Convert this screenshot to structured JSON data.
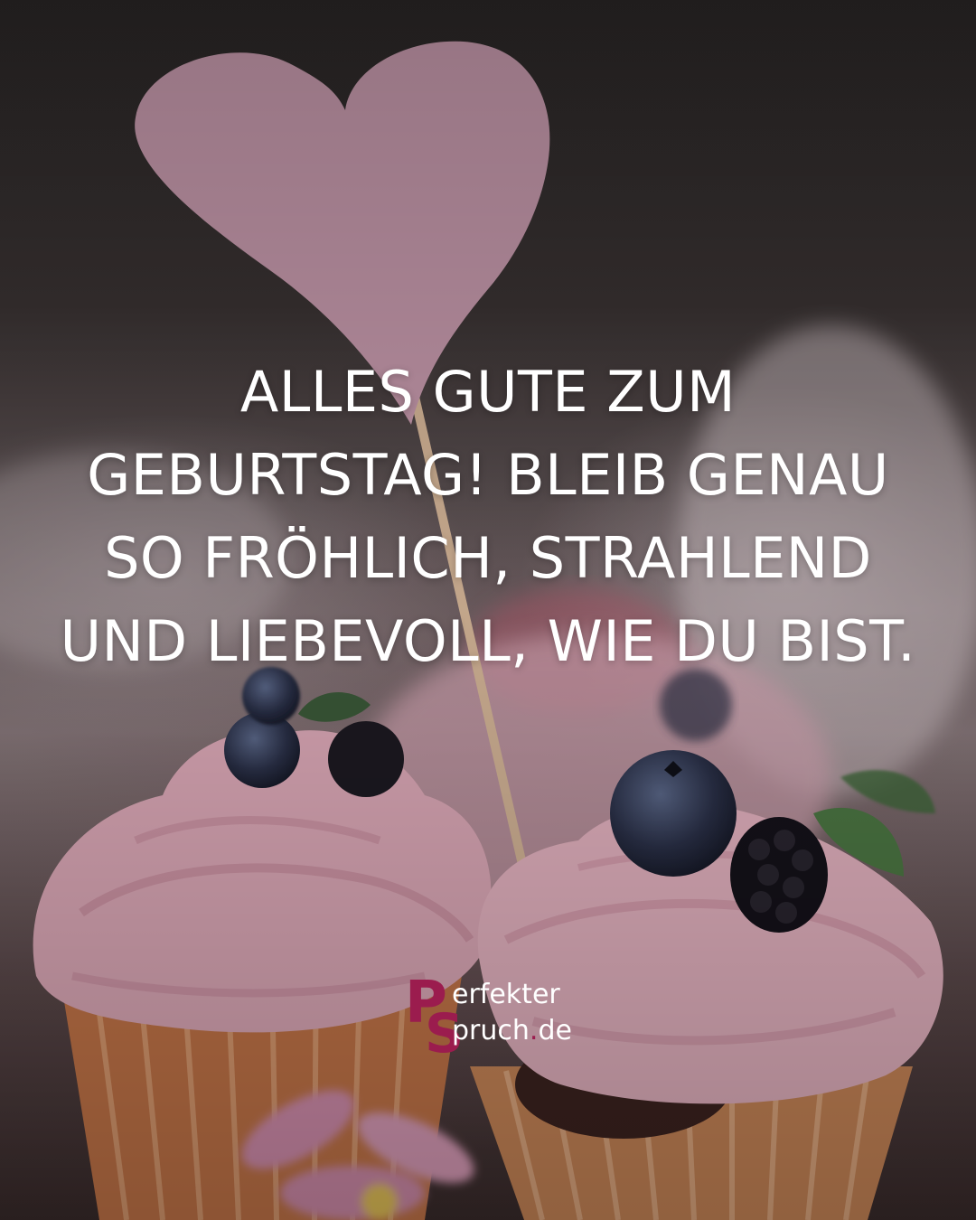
{
  "quote": {
    "lines": [
      "ALLES GUTE ZUM",
      "GEBURTSTAG! BLEIB GENAU",
      "SO FRÖHLICH, STRAHLEND",
      "UND LIEBEVOLL, WIE DU BIST."
    ]
  },
  "logo": {
    "letter_p": "P",
    "letter_s": "S",
    "word_1": "erfekter",
    "word_2": "pruch",
    "dot": ".",
    "tld": "de"
  },
  "colors": {
    "brand": "#9b1c4e",
    "text": "#ffffff",
    "heart": "#d9a9bd",
    "frosting": "#e8b3c2"
  }
}
